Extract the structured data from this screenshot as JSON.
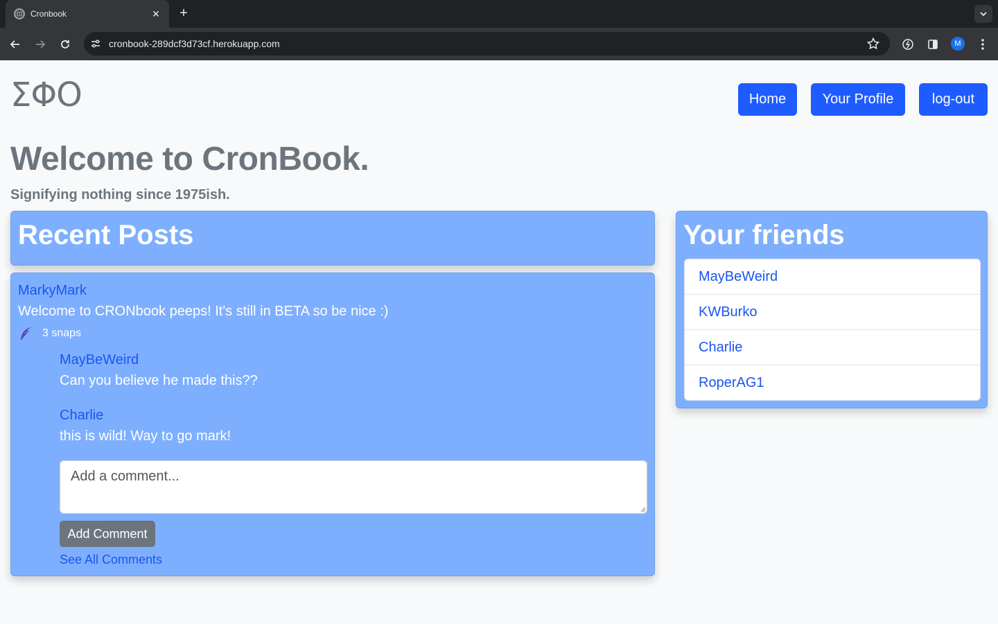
{
  "browser": {
    "tab_title": "Cronbook",
    "tab_close": "✕",
    "new_tab": "+",
    "url": "cronbook-289dcf3d73cf.herokuapp.com",
    "profile_initial": "M"
  },
  "header": {
    "logo": "ΣΦΟ",
    "nav": {
      "home": "Home",
      "profile": "Your Profile",
      "logout": "log-out"
    }
  },
  "hero": {
    "title": "Welcome to CronBook.",
    "subtitle": "Signifying nothing since 1975ish."
  },
  "posts": {
    "heading": "Recent Posts",
    "post": {
      "author": "MarkyMark",
      "text": "Welcome to CRONbook peeps! It's still in BETA so be nice :)",
      "snaps": "3 snaps",
      "comments": [
        {
          "author": "MayBeWeird",
          "text": "Can you believe he made this??"
        },
        {
          "author": "Charlie",
          "text": "this is wild! Way to go mark!"
        }
      ],
      "comment_placeholder": "Add a comment...",
      "add_comment_label": "Add Comment",
      "see_all_label": "See All Comments"
    }
  },
  "friends": {
    "heading": "Your friends",
    "list": [
      "MayBeWeird",
      "KWBurko",
      "Charlie",
      "RoperAG1"
    ]
  },
  "colors": {
    "card_bg": "#7eaffe",
    "primary": "#1f5cff",
    "link": "#1a55f0",
    "muted": "#6c757d"
  }
}
